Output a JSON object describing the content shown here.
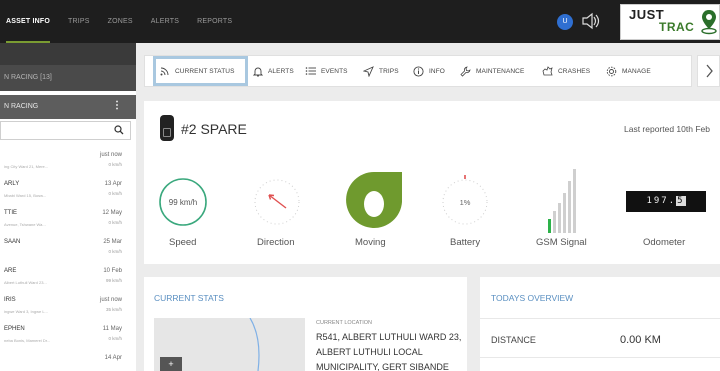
{
  "topnav": {
    "items": [
      {
        "label": "ASSET INFO",
        "active": true
      },
      {
        "label": "TRIPS",
        "active": false
      },
      {
        "label": "ZONES",
        "active": false
      },
      {
        "label": "ALERTS",
        "active": false
      },
      {
        "label": "REPORTS",
        "active": false
      }
    ],
    "user_initial": "U",
    "logo_line1": "JUST",
    "logo_line2": "TRAC"
  },
  "sidebar": {
    "group_label": "N RACING [13]",
    "selected_label": "N RACING",
    "search_placeholder": "",
    "items": [
      {
        "name": "",
        "addr": "ing City Ward 21, Mere...",
        "time": "just now",
        "speed": "0 km/h"
      },
      {
        "name": "ARLY",
        "addr": "Mbabi Ward 15, Bosw...",
        "time": "13 Apr",
        "speed": "0 km/h"
      },
      {
        "name": "TTIE",
        "addr": "Avenue, Tshwane Wa...",
        "time": "12 May",
        "speed": "0 km/h"
      },
      {
        "name": "SAAN",
        "addr": "",
        "time": "25 Mar",
        "speed": "0 km/h"
      },
      {
        "name": "ARE",
        "addr": "Albert Luthuli Ward 23...",
        "time": "10 Feb",
        "speed": "99 km/h"
      },
      {
        "name": "IRIS",
        "addr": "ingwe Ward 3, Ingwe L...",
        "time": "just now",
        "speed": "35 km/h"
      },
      {
        "name": "EPHEN",
        "addr": "neba Bonis, Mamerei Dr...",
        "time": "11 May",
        "speed": "0 km/h"
      },
      {
        "name": "",
        "addr": "",
        "time": "14 Apr",
        "speed": ""
      }
    ]
  },
  "tabs": [
    {
      "label": "CURRENT STATUS",
      "icon": "signal-icon",
      "active": true
    },
    {
      "label": "ALERTS",
      "icon": "bell-icon",
      "active": false
    },
    {
      "label": "EVENTS",
      "icon": "list-icon",
      "active": false
    },
    {
      "label": "TRIPS",
      "icon": "navigation-icon",
      "active": false
    },
    {
      "label": "INFO",
      "icon": "info-icon",
      "active": false
    },
    {
      "label": "MAINTENANCE",
      "icon": "wrench-icon",
      "active": false
    },
    {
      "label": "CRASHES",
      "icon": "crash-icon",
      "active": false
    },
    {
      "label": "MANAGE",
      "icon": "gear-icon",
      "active": false
    }
  ],
  "status": {
    "asset_title": "#2 SPARE",
    "last_reported": "Last reported 10th Feb",
    "speed_value": "99 km/h",
    "speed_label": "Speed",
    "direction_label": "Direction",
    "moving_label": "Moving",
    "battery_value": "1%",
    "battery_level": 0.01,
    "battery_label": "Battery",
    "gsm_label": "GSM Signal",
    "gsm_bars_lit": 1,
    "gsm_bars_total": 6,
    "odometer_digits": "197.",
    "odometer_last": "5",
    "odometer_label": "Odometer",
    "colors": {
      "speed_ring": "#3aa87d",
      "direction_arrow": "#e05050",
      "moving_fill": "#6f9a2e",
      "gsm_active": "#2db24a"
    }
  },
  "current_stats": {
    "heading": "CURRENT STATS",
    "location_caption": "CURRENT LOCATION",
    "location_text": "R541, ALBERT LUTHULI WARD 23, ALBERT LUTHULI LOCAL MUNICIPALITY, GERT SIBANDE",
    "map_plus": "+"
  },
  "today_overview": {
    "heading": "TODAYS OVERVIEW",
    "distance_label": "DISTANCE",
    "distance_value": "0.00 KM"
  }
}
